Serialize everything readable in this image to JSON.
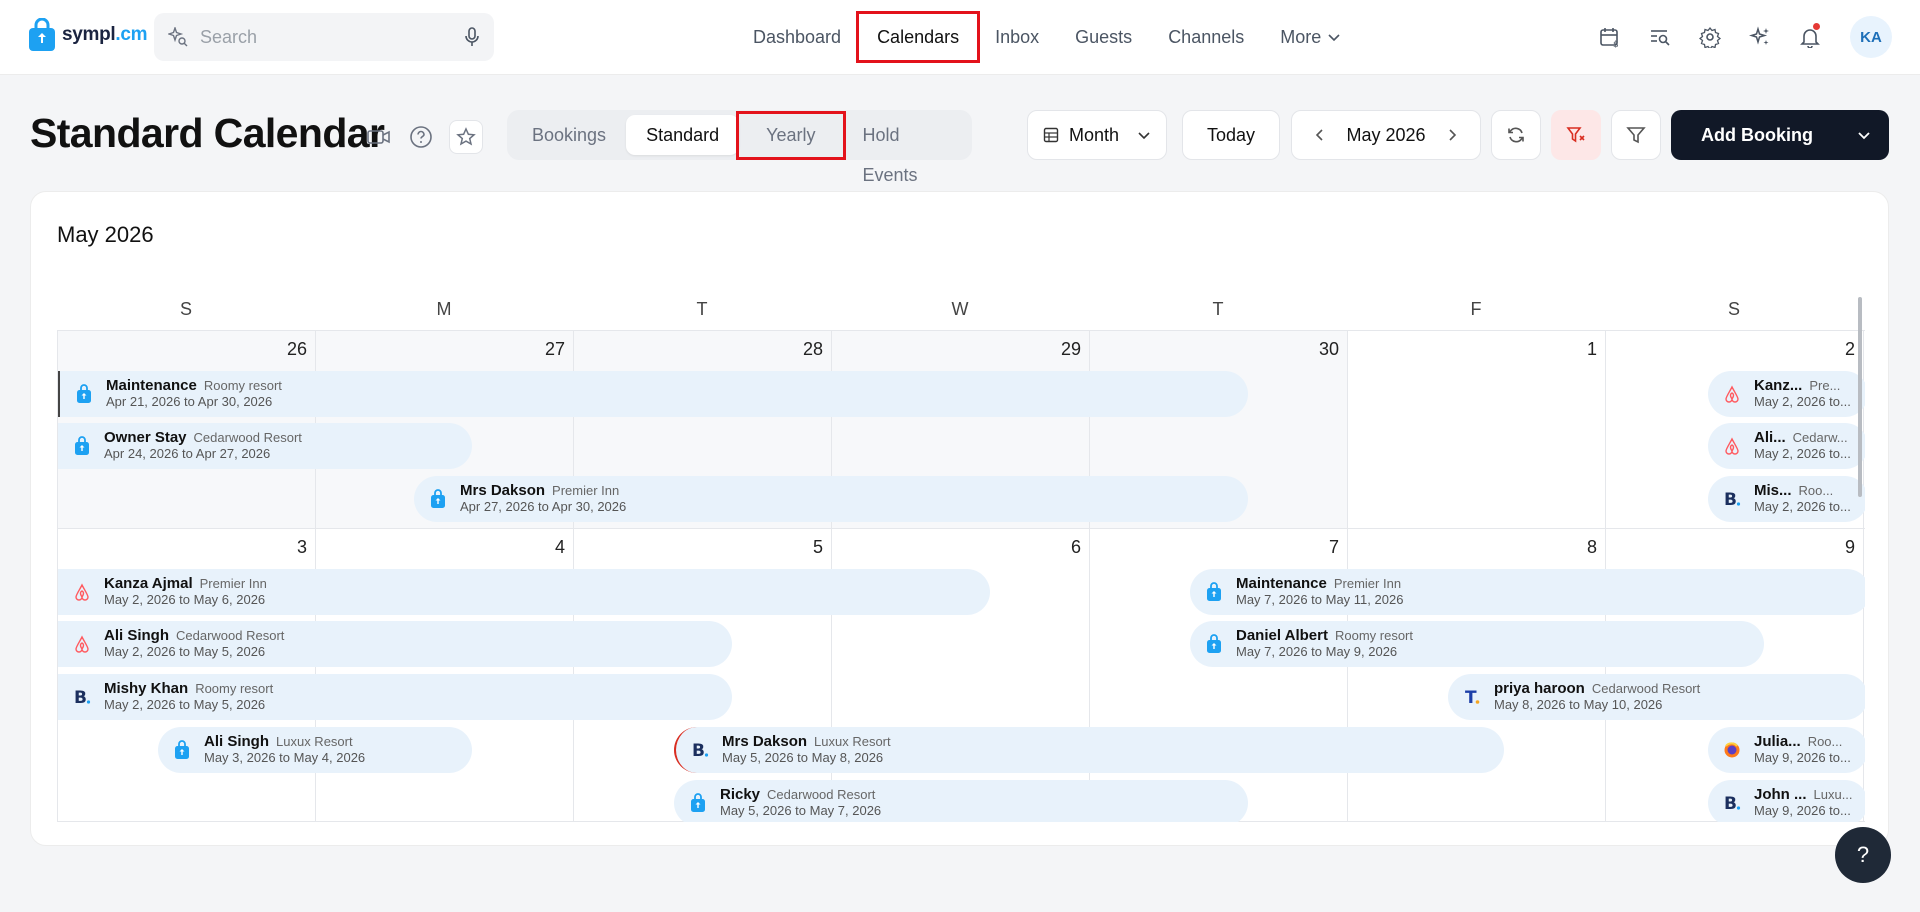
{
  "app": {
    "logo_main": "sympl",
    "logo_suffix": ".cm"
  },
  "search": {
    "placeholder": "Search"
  },
  "nav": {
    "items": [
      {
        "label": "Dashboard"
      },
      {
        "label": "Calendars"
      },
      {
        "label": "Inbox"
      },
      {
        "label": "Guests"
      },
      {
        "label": "Channels"
      },
      {
        "label": "More"
      }
    ]
  },
  "user": {
    "initials": "KA"
  },
  "page": {
    "title": "Standard Calendar"
  },
  "view_tabs": [
    "Bookings",
    "Standard",
    "Yearly",
    "Hold Events"
  ],
  "controls": {
    "view_mode": "Month",
    "today_label": "Today",
    "current_month": "May 2026",
    "add_booking_label": "Add Booking"
  },
  "calendar": {
    "title": "May 2026",
    "weekdays": [
      "S",
      "M",
      "T",
      "W",
      "T",
      "F",
      "S"
    ],
    "weeks": [
      {
        "days": [
          "26",
          "27",
          "28",
          "29",
          "30",
          "1",
          "2"
        ],
        "events": [
          {
            "name": "Maintenance",
            "property": "Roomy resort",
            "dates": "Apr 21, 2026 to Apr 30, 2026",
            "source": "sympl"
          },
          {
            "name": "Owner Stay",
            "property": "Cedarwood Resort",
            "dates": "Apr 24, 2026 to Apr 27, 2026",
            "source": "sympl"
          },
          {
            "name": "Mrs Dakson",
            "property": "Premier Inn",
            "dates": "Apr 27, 2026 to Apr 30, 2026",
            "source": "sympl"
          },
          {
            "name": "Kanz...",
            "property": "Pre...",
            "dates": "May 2, 2026 to...",
            "source": "airbnb"
          },
          {
            "name": "Ali...",
            "property": "Cedarw...",
            "dates": "May 2, 2026 to...",
            "source": "airbnb"
          },
          {
            "name": "Mis...",
            "property": "Roo...",
            "dates": "May 2, 2026 to...",
            "source": "booking"
          }
        ]
      },
      {
        "days": [
          "3",
          "4",
          "5",
          "6",
          "7",
          "8",
          "9"
        ],
        "events": [
          {
            "name": "Kanza Ajmal",
            "property": "Premier Inn",
            "dates": "May 2, 2026 to May 6, 2026",
            "source": "airbnb"
          },
          {
            "name": "Ali Singh",
            "property": "Cedarwood Resort",
            "dates": "May 2, 2026 to May 5, 2026",
            "source": "airbnb"
          },
          {
            "name": "Mishy Khan",
            "property": "Roomy resort",
            "dates": "May 2, 2026 to May 5, 2026",
            "source": "booking"
          },
          {
            "name": "Ali Singh",
            "property": "Luxux Resort",
            "dates": "May 3, 2026 to May 4, 2026",
            "source": "sympl"
          },
          {
            "name": "Mrs Dakson",
            "property": "Luxux Resort",
            "dates": "May 5, 2026 to May 8, 2026",
            "source": "booking"
          },
          {
            "name": "Ricky",
            "property": "Cedarwood Resort",
            "dates": "May 5, 2026 to May 7, 2026",
            "source": "sympl"
          },
          {
            "name": "Maintenance",
            "property": "Premier Inn",
            "dates": "May 7, 2026 to May 11, 2026",
            "source": "sympl"
          },
          {
            "name": "Daniel Albert",
            "property": "Roomy resort",
            "dates": "May 7, 2026 to May 9, 2026",
            "source": "sympl"
          },
          {
            "name": "priya haroon",
            "property": "Cedarwood Resort",
            "dates": "May 8, 2026 to May 10, 2026",
            "source": "tripadvisor"
          },
          {
            "name": "Julia...",
            "property": "Roo...",
            "dates": "May 9, 2026 to...",
            "source": "firefox"
          },
          {
            "name": "John ...",
            "property": "Luxu...",
            "dates": "May 9, 2026 to...",
            "source": "booking"
          }
        ]
      }
    ]
  },
  "help": {
    "label": "?"
  },
  "colors": {
    "accent": "#1da1f2",
    "highlight_box": "#e3121b",
    "event_bg": "#e8f2fb",
    "primary_button": "#111827"
  },
  "icons": {
    "search": "sparkle-search-icon",
    "mic": "microphone-icon",
    "top_right": [
      "calendar-dollar-icon",
      "search-list-icon",
      "settings-gear-icon",
      "ai-sparkles-icon",
      "bell-icon"
    ],
    "title": [
      "video-icon",
      "help-circle-icon",
      "star-icon"
    ]
  }
}
